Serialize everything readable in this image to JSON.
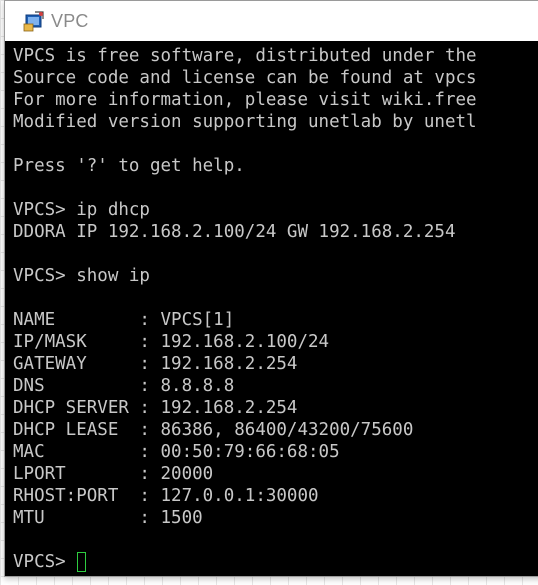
{
  "window": {
    "title": "VPC",
    "icon": "vpcs-terminal-icon"
  },
  "terminal": {
    "lines": [
      "VPCS is free software, distributed under the",
      "Source code and license can be found at vpcs",
      "For more information, please visit wiki.free",
      "Modified version supporting unetlab by unetl",
      "",
      "Press '?' to get help.",
      "",
      "VPCS> ip dhcp",
      "DDORA IP 192.168.2.100/24 GW 192.168.2.254",
      "",
      "VPCS> show ip",
      "",
      "NAME        : VPCS[1]",
      "IP/MASK     : 192.168.2.100/24",
      "GATEWAY     : 192.168.2.254",
      "DNS         : 8.8.8.8",
      "DHCP SERVER : 192.168.2.254",
      "DHCP LEASE  : 86386, 86400/43200/75600",
      "MAC         : 00:50:79:66:68:05",
      "LPORT       : 20000",
      "RHOST:PORT  : 127.0.0.1:30000",
      "MTU         : 1500",
      ""
    ],
    "prompt": "VPCS> ",
    "colors": {
      "background": "#000000",
      "text": "#c8c8c8",
      "cursor": "#2ecc40"
    }
  }
}
